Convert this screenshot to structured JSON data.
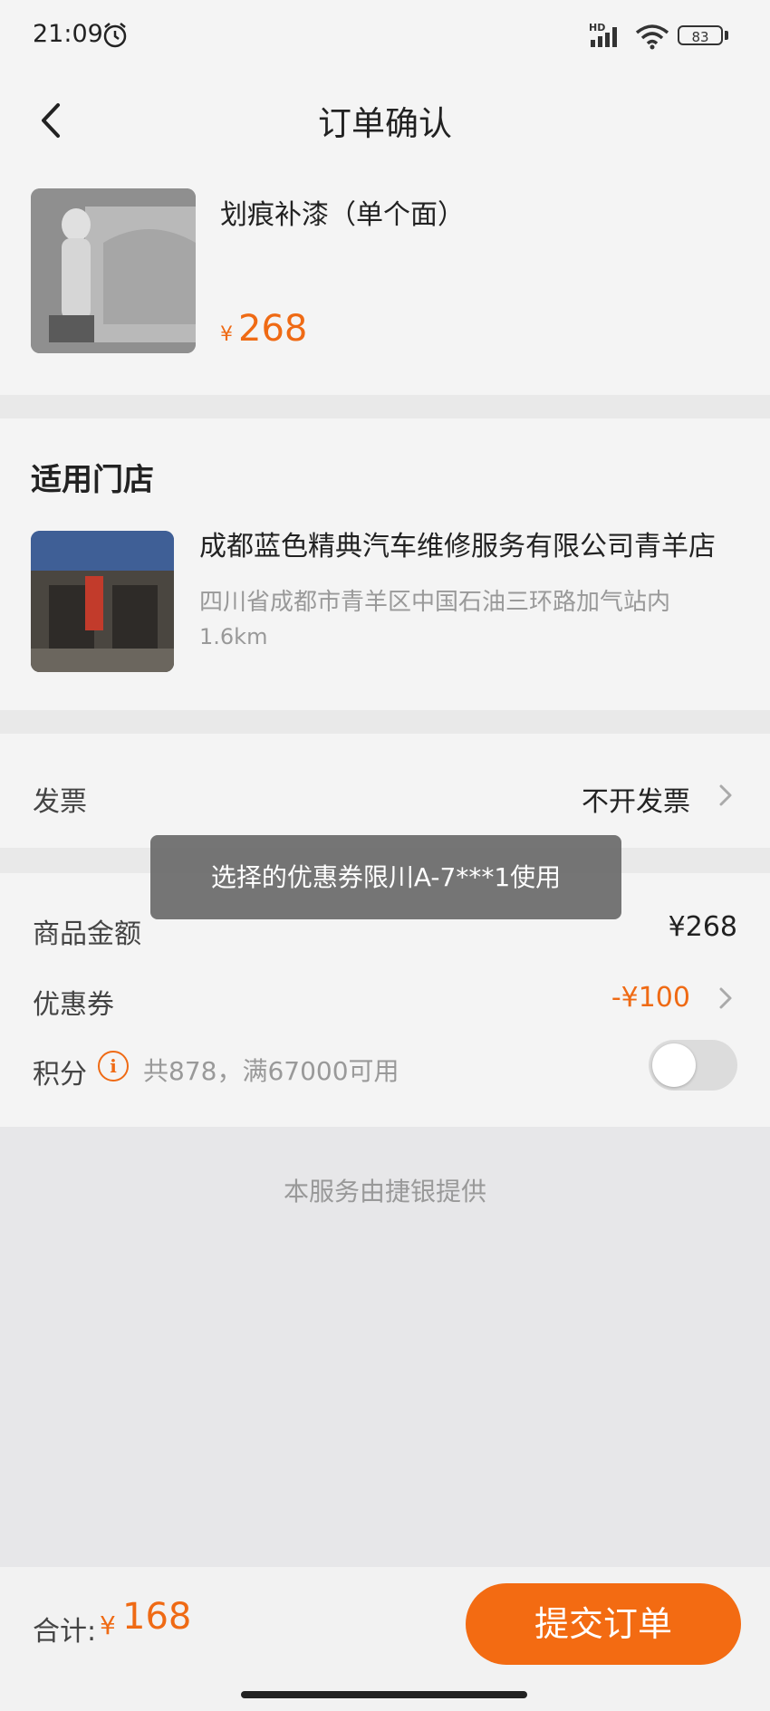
{
  "status_bar": {
    "time": "21:09",
    "network_label": "HD",
    "battery": "83",
    "icons": [
      "alarm-icon",
      "signal-icon",
      "wifi-icon",
      "battery-icon"
    ]
  },
  "nav": {
    "back_icon": "chevron-left-icon",
    "title": "订单确认"
  },
  "product": {
    "name": "划痕补漆（单个面）",
    "currency": "¥",
    "price": "268"
  },
  "store_section": {
    "title": "适用门店",
    "store_name": "成都蓝色精典汽车维修服务有限公司青羊店",
    "address": "四川省成都市青羊区中国石油三环路加气站内",
    "distance": "1.6km"
  },
  "invoice": {
    "label": "发票",
    "value": "不开发票"
  },
  "amounts": {
    "goods_label": "商品金额",
    "goods_value": "¥268",
    "coupon_label": "优惠券",
    "coupon_value": "-¥100",
    "points_label": "积分",
    "points_desc": "共878，满67000可用",
    "points_toggle": false
  },
  "provider": "本服务由捷银提供",
  "toast": "选择的优惠券限川A-7***1使用",
  "bottom": {
    "total_label": "合计:",
    "currency": "¥",
    "total_value": "168",
    "submit_label": "提交订单"
  },
  "colors": {
    "accent": "#ef6a14",
    "button": "#f36b12"
  }
}
